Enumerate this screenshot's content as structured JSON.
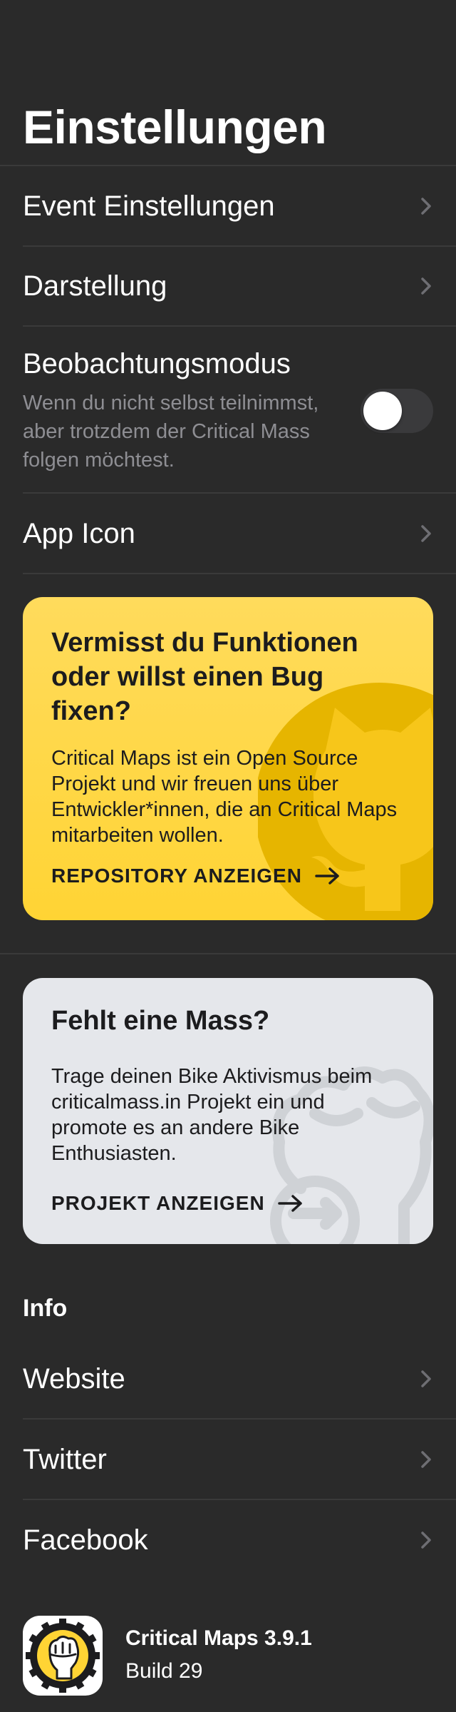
{
  "header": {
    "title": "Einstellungen"
  },
  "settings": {
    "event_settings": "Event Einstellungen",
    "appearance": "Darstellung",
    "observation_mode": {
      "title": "Beobachtungsmodus",
      "subtitle": "Wenn du nicht selbst teilnimmst, aber trotzdem der Critical Mass folgen möchtest.",
      "enabled": false
    },
    "app_icon": "App Icon"
  },
  "cards": {
    "github": {
      "title": "Vermisst du Funktionen oder willst einen Bug fixen?",
      "body": "Critical Maps ist ein Open Source Projekt und wir freuen uns über Entwickler*innen, die an Critical Maps mitarbeiten wollen.",
      "link": "REPOSITORY ANZEIGEN",
      "icon": "github-octocat-icon",
      "color": "#ffd434"
    },
    "mass": {
      "title": "Fehlt eine Mass?",
      "body": "Trage deinen Bike Aktivismus beim criticalmass.in Projekt ein und promote es an andere Bike Enthusiasten.",
      "link": "PROJEKT ANZEIGEN",
      "icon": "raised-fist-icon",
      "color": "#e5e7eb"
    }
  },
  "info": {
    "header": "Info",
    "links": [
      "Website",
      "Twitter",
      "Facebook"
    ]
  },
  "app": {
    "name": "Critical Maps 3.9.1",
    "build": "Build 29",
    "icon": "critical-maps-logo-icon"
  },
  "colors": {
    "background": "#2a2a2a",
    "secondary_text": "#8e8e93",
    "chevron": "#6e6e73",
    "accent_yellow": "#ffd434"
  }
}
